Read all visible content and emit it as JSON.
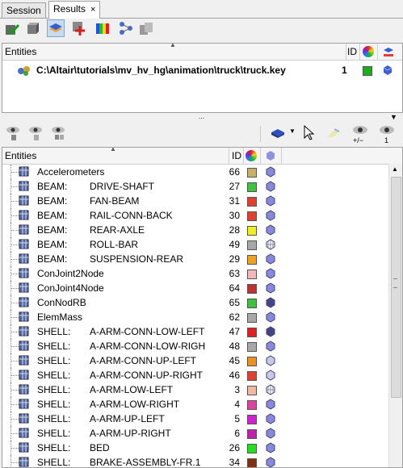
{
  "tabs": [
    {
      "label": "Session"
    },
    {
      "label": "Results",
      "close": "×"
    }
  ],
  "toolbar_icons": [
    "check-icon",
    "box-icon",
    "layer-icon",
    "add-icon",
    "contour-icon",
    "network-icon",
    "stack-icon"
  ],
  "pane1": {
    "header": {
      "entities": "Entities",
      "id": "ID"
    },
    "file": {
      "path": "C:\\Altair\\tutorials\\mv_hv_hg\\animation\\truck\\truck.key",
      "id": "1",
      "color": "#22aa22"
    }
  },
  "splitter": "...",
  "pane2": {
    "header": {
      "entities": "Entities",
      "id": "ID"
    },
    "rows": [
      {
        "name": "Accelerometers",
        "sub": "",
        "id": "66",
        "color": "#c8b068",
        "style": "solid"
      },
      {
        "name": "BEAM:",
        "sub": "DRIVE-SHAFT",
        "id": "27",
        "color": "#3fc23f",
        "style": "solid"
      },
      {
        "name": "BEAM:",
        "sub": "FAN-BEAM",
        "id": "31",
        "color": "#e04030",
        "style": "solid"
      },
      {
        "name": "BEAM:",
        "sub": "RAIL-CONN-BACK",
        "id": "30",
        "color": "#e04030",
        "style": "solid"
      },
      {
        "name": "BEAM:",
        "sub": "REAR-AXLE",
        "id": "28",
        "color": "#f0f020",
        "style": "solid"
      },
      {
        "name": "BEAM:",
        "sub": "ROLL-BAR",
        "id": "49",
        "color": "#a8a8a8",
        "style": "wire"
      },
      {
        "name": "BEAM:",
        "sub": "SUSPENSION-REAR",
        "id": "29",
        "color": "#f0a020",
        "style": "solid"
      },
      {
        "name": "ConJoint2Node",
        "sub": "",
        "id": "63",
        "color": "#f0b8b8",
        "style": "solid"
      },
      {
        "name": "ConJoint4Node",
        "sub": "",
        "id": "64",
        "color": "#c03030",
        "style": "solid"
      },
      {
        "name": "ConNodRB",
        "sub": "",
        "id": "65",
        "color": "#3fc23f",
        "style": "dark"
      },
      {
        "name": "ElemMass",
        "sub": "",
        "id": "62",
        "color": "#a8a8a8",
        "style": "solid"
      },
      {
        "name": "SHELL:",
        "sub": "A-ARM-CONN-LOW-LEFT",
        "id": "47",
        "color": "#e02020",
        "style": "dark"
      },
      {
        "name": "SHELL:",
        "sub": "A-ARM-CONN-LOW-RIGH",
        "id": "48",
        "color": "#a8a8a8",
        "style": "solid"
      },
      {
        "name": "SHELL:",
        "sub": "A-ARM-CONN-UP-LEFT",
        "id": "45",
        "color": "#f09020",
        "style": "light"
      },
      {
        "name": "SHELL:",
        "sub": "A-ARM-CONN-UP-RIGHT",
        "id": "46",
        "color": "#e04030",
        "style": "light"
      },
      {
        "name": "SHELL:",
        "sub": "A-ARM-LOW-LEFT",
        "id": "3",
        "color": "#f0b8a0",
        "style": "wire"
      },
      {
        "name": "SHELL:",
        "sub": "A-ARM-LOW-RIGHT",
        "id": "4",
        "color": "#e040a0",
        "style": "solid"
      },
      {
        "name": "SHELL:",
        "sub": "A-ARM-UP-LEFT",
        "id": "5",
        "color": "#d020d0",
        "style": "solid"
      },
      {
        "name": "SHELL:",
        "sub": "A-ARM-UP-RIGHT",
        "id": "6",
        "color": "#c020b0",
        "style": "solid"
      },
      {
        "name": "SHELL:",
        "sub": "BED",
        "id": "26",
        "color": "#20e020",
        "style": "solid"
      },
      {
        "name": "SHELL:",
        "sub": "BRAKE-ASSEMBLY-FR.1",
        "id": "34",
        "color": "#803010",
        "style": "solid"
      }
    ]
  }
}
